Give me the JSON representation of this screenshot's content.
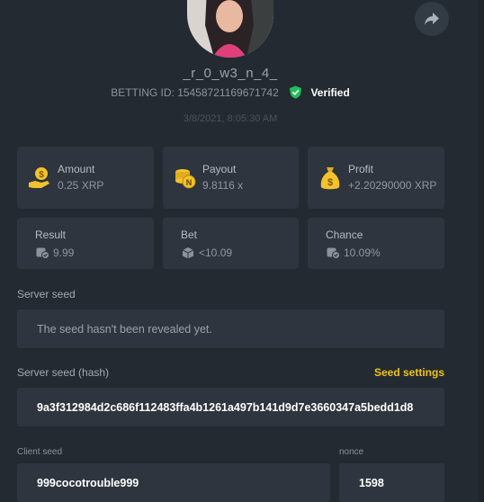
{
  "profile": {
    "username": "_r_0_w3_n_4_",
    "betting_id": "BETTING ID: 15458721169671742",
    "verified_label": "Verified",
    "date": "3/8/2021, 8:05:30 AM"
  },
  "icons": {
    "share": "share-icon",
    "verified": "check-shield-icon"
  },
  "colors": {
    "accent": "#f0c419",
    "verified": "#1fbf5a",
    "background": "#242a31",
    "card": "#2e353e"
  },
  "stats": {
    "amount": {
      "label": "Amount",
      "value": "0.25 XRP"
    },
    "payout": {
      "label": "Payout",
      "value": "9.8116 x"
    },
    "profit": {
      "label": "Profit",
      "value": "+2.20290000 XRP"
    }
  },
  "bet_info": {
    "result": {
      "label": "Result",
      "value": "9.99"
    },
    "bet": {
      "label": "Bet",
      "value": "<10.09"
    },
    "chance": {
      "label": "Chance",
      "value": "10.09%"
    }
  },
  "server_seed": {
    "label": "Server seed",
    "value": "The seed hasn't been revealed yet."
  },
  "server_seed_hash": {
    "label": "Server seed (hash)",
    "settings_link": "Seed settings",
    "value": "9a3f312984d2c686f112483ffa4b1261a497b141d9d7e3660347a5bedd1d8"
  },
  "client_seed": {
    "label": "Client seed",
    "value": "999cocotrouble999"
  },
  "nonce": {
    "label": "nonce",
    "value": "1598"
  }
}
